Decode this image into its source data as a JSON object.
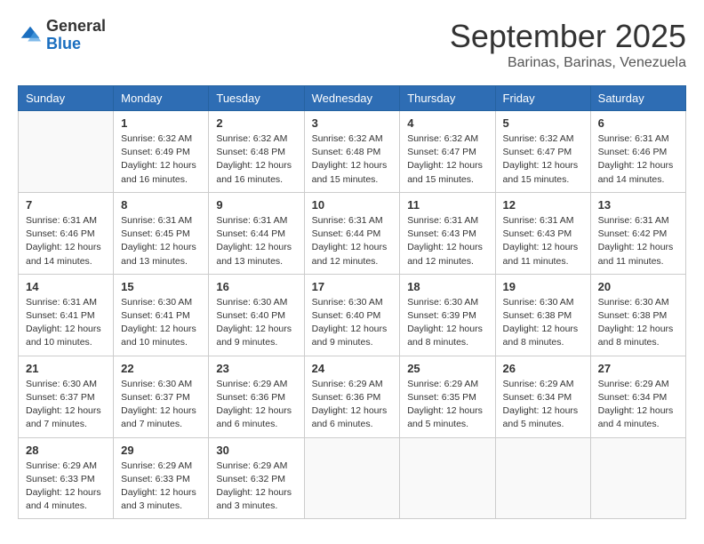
{
  "header": {
    "logo_general": "General",
    "logo_blue": "Blue",
    "month_title": "September 2025",
    "location": "Barinas, Barinas, Venezuela"
  },
  "days_of_week": [
    "Sunday",
    "Monday",
    "Tuesday",
    "Wednesday",
    "Thursday",
    "Friday",
    "Saturday"
  ],
  "weeks": [
    [
      {
        "day": "",
        "info": ""
      },
      {
        "day": "1",
        "info": "Sunrise: 6:32 AM\nSunset: 6:49 PM\nDaylight: 12 hours\nand 16 minutes."
      },
      {
        "day": "2",
        "info": "Sunrise: 6:32 AM\nSunset: 6:48 PM\nDaylight: 12 hours\nand 16 minutes."
      },
      {
        "day": "3",
        "info": "Sunrise: 6:32 AM\nSunset: 6:48 PM\nDaylight: 12 hours\nand 15 minutes."
      },
      {
        "day": "4",
        "info": "Sunrise: 6:32 AM\nSunset: 6:47 PM\nDaylight: 12 hours\nand 15 minutes."
      },
      {
        "day": "5",
        "info": "Sunrise: 6:32 AM\nSunset: 6:47 PM\nDaylight: 12 hours\nand 15 minutes."
      },
      {
        "day": "6",
        "info": "Sunrise: 6:31 AM\nSunset: 6:46 PM\nDaylight: 12 hours\nand 14 minutes."
      }
    ],
    [
      {
        "day": "7",
        "info": "Sunrise: 6:31 AM\nSunset: 6:46 PM\nDaylight: 12 hours\nand 14 minutes."
      },
      {
        "day": "8",
        "info": "Sunrise: 6:31 AM\nSunset: 6:45 PM\nDaylight: 12 hours\nand 13 minutes."
      },
      {
        "day": "9",
        "info": "Sunrise: 6:31 AM\nSunset: 6:44 PM\nDaylight: 12 hours\nand 13 minutes."
      },
      {
        "day": "10",
        "info": "Sunrise: 6:31 AM\nSunset: 6:44 PM\nDaylight: 12 hours\nand 12 minutes."
      },
      {
        "day": "11",
        "info": "Sunrise: 6:31 AM\nSunset: 6:43 PM\nDaylight: 12 hours\nand 12 minutes."
      },
      {
        "day": "12",
        "info": "Sunrise: 6:31 AM\nSunset: 6:43 PM\nDaylight: 12 hours\nand 11 minutes."
      },
      {
        "day": "13",
        "info": "Sunrise: 6:31 AM\nSunset: 6:42 PM\nDaylight: 12 hours\nand 11 minutes."
      }
    ],
    [
      {
        "day": "14",
        "info": "Sunrise: 6:31 AM\nSunset: 6:41 PM\nDaylight: 12 hours\nand 10 minutes."
      },
      {
        "day": "15",
        "info": "Sunrise: 6:30 AM\nSunset: 6:41 PM\nDaylight: 12 hours\nand 10 minutes."
      },
      {
        "day": "16",
        "info": "Sunrise: 6:30 AM\nSunset: 6:40 PM\nDaylight: 12 hours\nand 9 minutes."
      },
      {
        "day": "17",
        "info": "Sunrise: 6:30 AM\nSunset: 6:40 PM\nDaylight: 12 hours\nand 9 minutes."
      },
      {
        "day": "18",
        "info": "Sunrise: 6:30 AM\nSunset: 6:39 PM\nDaylight: 12 hours\nand 8 minutes."
      },
      {
        "day": "19",
        "info": "Sunrise: 6:30 AM\nSunset: 6:38 PM\nDaylight: 12 hours\nand 8 minutes."
      },
      {
        "day": "20",
        "info": "Sunrise: 6:30 AM\nSunset: 6:38 PM\nDaylight: 12 hours\nand 8 minutes."
      }
    ],
    [
      {
        "day": "21",
        "info": "Sunrise: 6:30 AM\nSunset: 6:37 PM\nDaylight: 12 hours\nand 7 minutes."
      },
      {
        "day": "22",
        "info": "Sunrise: 6:30 AM\nSunset: 6:37 PM\nDaylight: 12 hours\nand 7 minutes."
      },
      {
        "day": "23",
        "info": "Sunrise: 6:29 AM\nSunset: 6:36 PM\nDaylight: 12 hours\nand 6 minutes."
      },
      {
        "day": "24",
        "info": "Sunrise: 6:29 AM\nSunset: 6:36 PM\nDaylight: 12 hours\nand 6 minutes."
      },
      {
        "day": "25",
        "info": "Sunrise: 6:29 AM\nSunset: 6:35 PM\nDaylight: 12 hours\nand 5 minutes."
      },
      {
        "day": "26",
        "info": "Sunrise: 6:29 AM\nSunset: 6:34 PM\nDaylight: 12 hours\nand 5 minutes."
      },
      {
        "day": "27",
        "info": "Sunrise: 6:29 AM\nSunset: 6:34 PM\nDaylight: 12 hours\nand 4 minutes."
      }
    ],
    [
      {
        "day": "28",
        "info": "Sunrise: 6:29 AM\nSunset: 6:33 PM\nDaylight: 12 hours\nand 4 minutes."
      },
      {
        "day": "29",
        "info": "Sunrise: 6:29 AM\nSunset: 6:33 PM\nDaylight: 12 hours\nand 3 minutes."
      },
      {
        "day": "30",
        "info": "Sunrise: 6:29 AM\nSunset: 6:32 PM\nDaylight: 12 hours\nand 3 minutes."
      },
      {
        "day": "",
        "info": ""
      },
      {
        "day": "",
        "info": ""
      },
      {
        "day": "",
        "info": ""
      },
      {
        "day": "",
        "info": ""
      }
    ]
  ]
}
